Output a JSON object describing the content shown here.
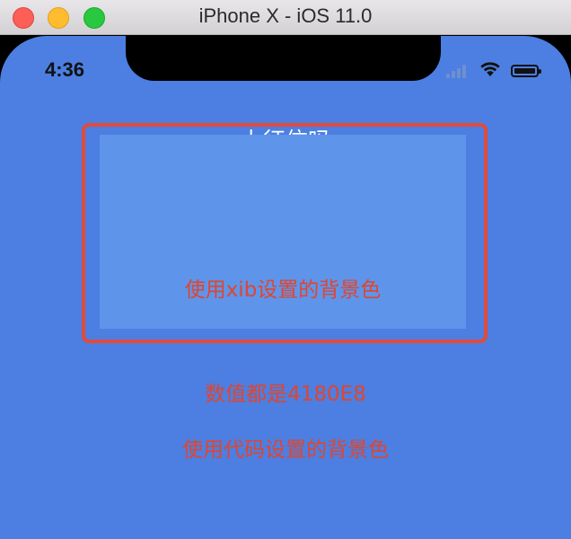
{
  "window": {
    "title": "iPhone X - iOS 11.0",
    "controls": [
      "close",
      "minimize",
      "zoom"
    ]
  },
  "status_bar": {
    "time": "4:36",
    "icons": [
      "signal-icon",
      "wifi-icon",
      "battery-icon"
    ]
  },
  "nav": {
    "title": "上征信吗"
  },
  "xib_view": {
    "label": "使用xib设置的背景色"
  },
  "info": {
    "value_line": "数值都是4180E8",
    "code_line": "使用代码设置的背景色"
  },
  "colors": {
    "screen_background": "#4c7fe1",
    "xib_background": "#5e95ea",
    "highlight_border": "#e34a3b",
    "label_text": "#e0452f"
  }
}
